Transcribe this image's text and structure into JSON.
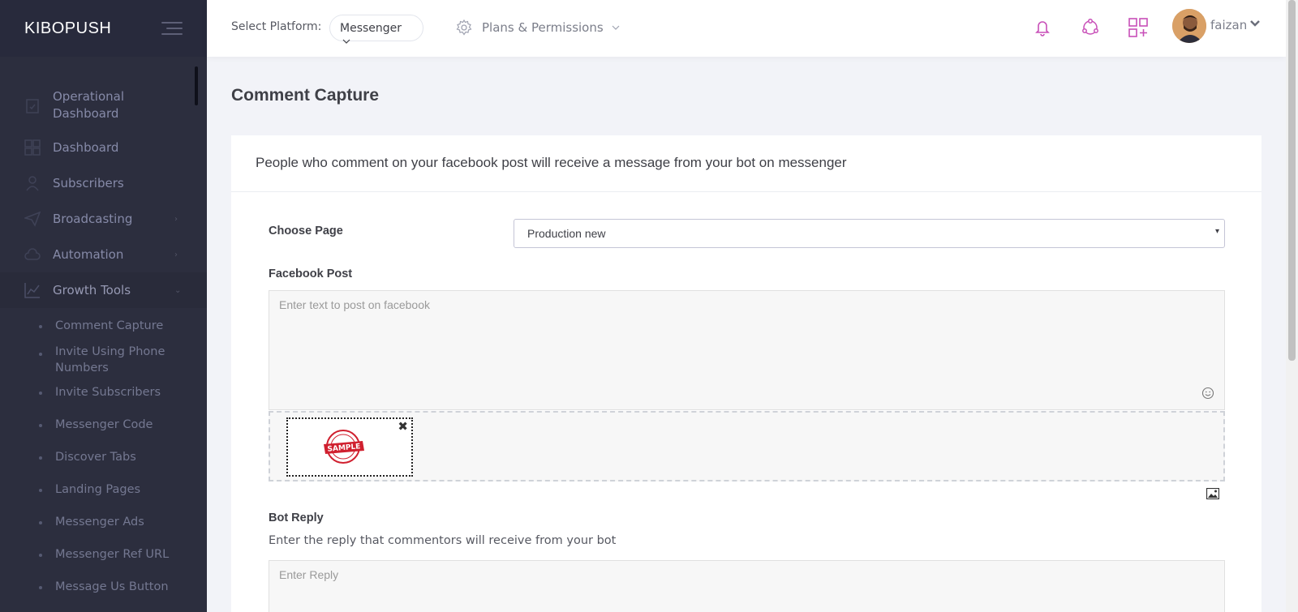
{
  "brand": "KIBOPUSH",
  "sidebar": {
    "items": [
      {
        "label": "Operational Dashboard",
        "icon": "clipboard-icon"
      },
      {
        "label": "Dashboard",
        "icon": "grid-icon"
      },
      {
        "label": "Subscribers",
        "icon": "user-icon"
      },
      {
        "label": "Broadcasting",
        "icon": "paper-plane-icon"
      },
      {
        "label": "Automation",
        "icon": "cloud-icon"
      },
      {
        "label": "Growth Tools",
        "icon": "chart-line-icon"
      }
    ],
    "subitems": [
      "Comment Capture",
      "Invite Using Phone Numbers",
      "Invite Subscribers",
      "Messenger Code",
      "Discover Tabs",
      "Landing Pages",
      "Messenger Ads",
      "Messenger Ref URL",
      "Message Us Button"
    ]
  },
  "header": {
    "platform_label": "Select Platform:",
    "platform_value": "Messenger",
    "plans_label": "Plans & Permissions",
    "user_name": "faizan"
  },
  "page": {
    "title": "Comment Capture",
    "panel_heading": "People who comment on your facebook post will receive a message from your bot on messenger",
    "choose_page_label": "Choose Page",
    "choose_page_value": "Production new",
    "facebook_post_label": "Facebook Post",
    "facebook_post_placeholder": "Enter text to post on facebook",
    "bot_reply_label": "Bot Reply",
    "bot_reply_desc": "Enter the reply that commentors will receive from your bot",
    "reply_placeholder": "Enter Reply",
    "stamp_text": "SAMPLE"
  },
  "colors": {
    "sidebar_bg": "#2c2e3e",
    "accent_pink": "#c84fb8",
    "stamp_red": "#d0202f"
  }
}
